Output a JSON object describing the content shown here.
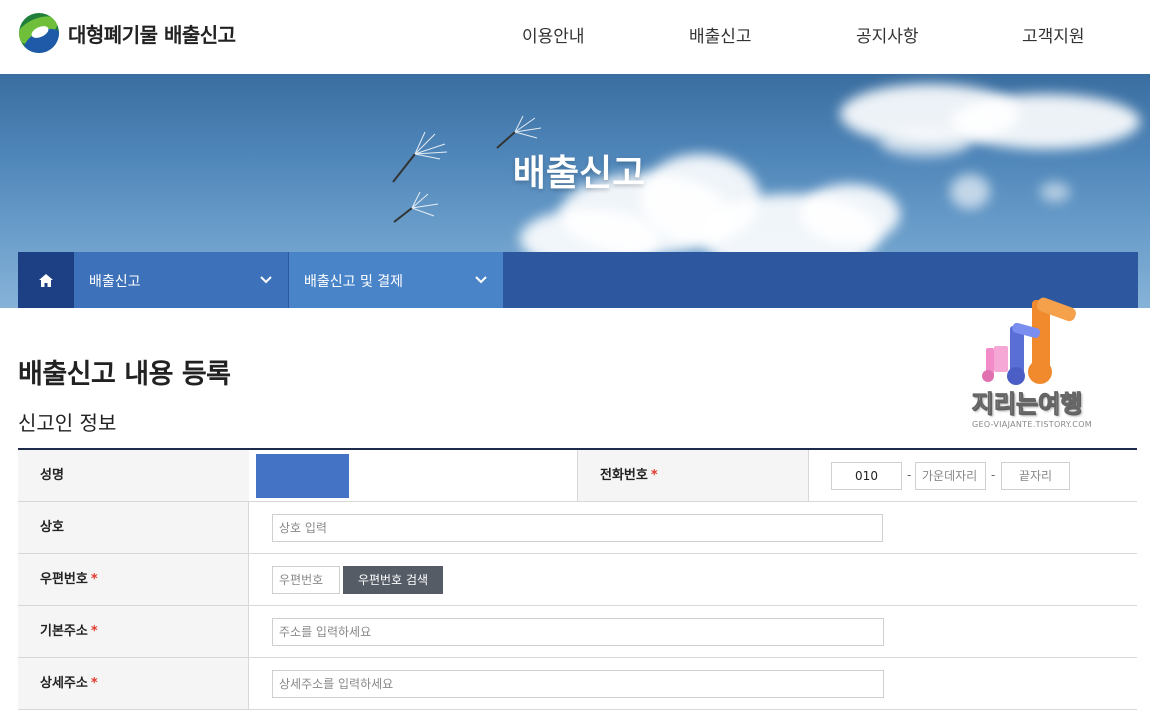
{
  "header": {
    "logo_text": "대형폐기물 배출신고",
    "nav": [
      "이용안내",
      "배출신고",
      "공지사항",
      "고객지원"
    ]
  },
  "banner": {
    "title": "배출신고"
  },
  "breadcrumb": {
    "items": [
      "배출신고",
      "배출신고 및 결제"
    ]
  },
  "main": {
    "page_title": "배출신고 내용 등록",
    "section_title": "신고인 정보"
  },
  "watermark": {
    "text": "지리는여행",
    "sub": "GEO-VIAJANTE.TISTORY.COM"
  },
  "form": {
    "name_label": "성명",
    "phone_label": "전화번호",
    "phone_prefix": "010",
    "phone_mid_placeholder": "가운데자리",
    "phone_last_placeholder": "끝자리",
    "phone_sep": "-",
    "company_label": "상호",
    "company_placeholder": "상호 입력",
    "zip_label": "우편번호",
    "zip_placeholder": "우편번호",
    "zip_search_button": "우편번호 검색",
    "addr_label": "기본주소",
    "addr_placeholder": "주소를 입력하세요",
    "addr_detail_label": "상세주소",
    "addr_detail_placeholder": "상세주소를 입력하세요",
    "required_mark": "*"
  },
  "colors": {
    "crumb_bg": "#2d58a0",
    "home_bg": "#1d3f84",
    "required": "#e23a2e",
    "button_dark": "#555c66"
  }
}
